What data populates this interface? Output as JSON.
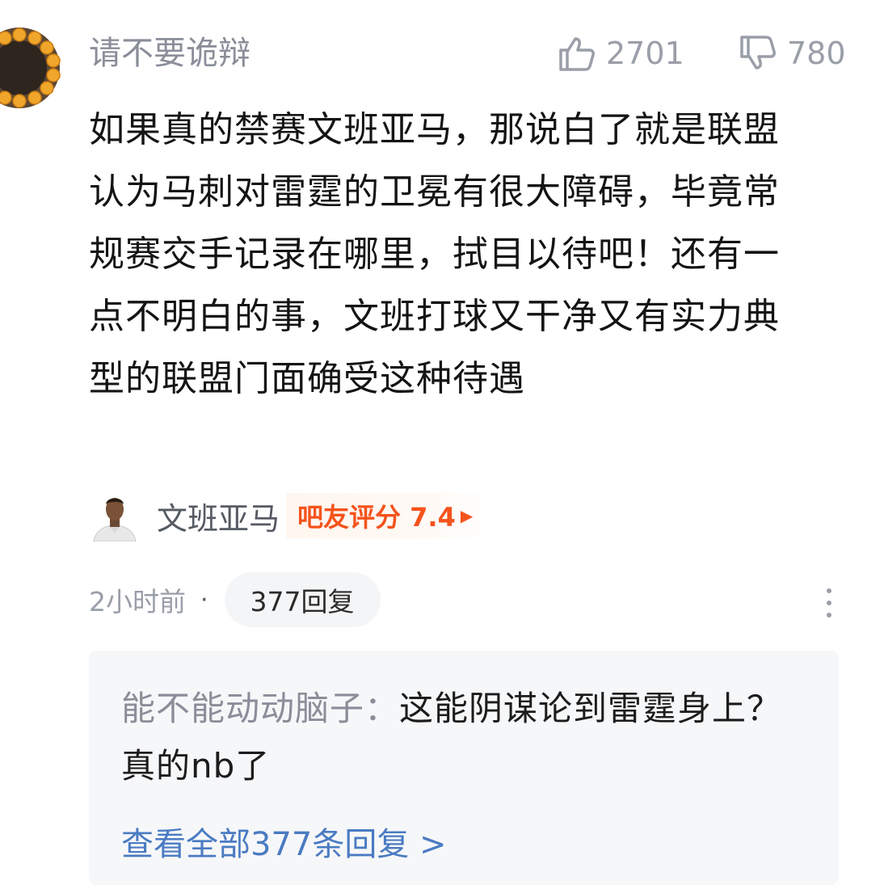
{
  "comment": {
    "username": "请不要诡辩",
    "avatar_icon": "bead-bracelet-avatar",
    "likes": "2701",
    "dislikes": "780",
    "text": "如果真的禁赛文班亚马，那说白了就是联盟认为马刺对雷霆的卫冕有很大障碍，毕竟常规赛交手记录在哪里，拭目以待吧！还有一点不明白的事，文班打球又干净又有实力典型的联盟门面确受这种待遇",
    "tag": {
      "name": "文班亚马",
      "rating": "吧友评分 7.4"
    },
    "time": "2小时前",
    "separator": "·",
    "reply_count": "377回复"
  },
  "reply_preview": {
    "author": "能不能动动脑子：",
    "text": "这能阴谋论到雷霆身上？真的nb了",
    "view_all": "查看全部377条回复 >"
  },
  "colors": {
    "accent_rating": "#f5531c",
    "link": "#4a7bc2",
    "muted": "#9a9ea8"
  }
}
